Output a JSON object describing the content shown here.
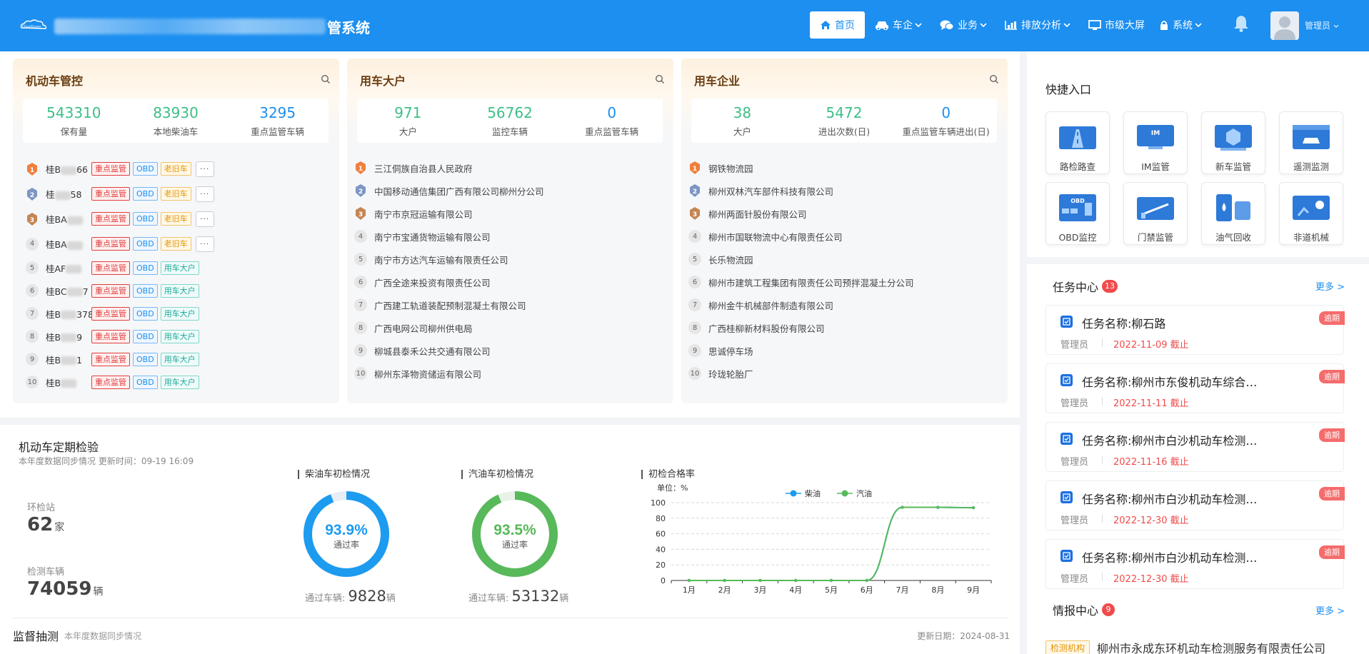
{
  "header": {
    "logo_text": "CloudScape",
    "title_suffix": "管系统",
    "nav": [
      {
        "label": "首页",
        "icon": "home-icon",
        "active": true
      },
      {
        "label": "车企",
        "icon": "car-icon",
        "caret": true
      },
      {
        "label": "业务",
        "icon": "chat-icon",
        "caret": true
      },
      {
        "label": "排放分析",
        "icon": "bar-chart-icon",
        "caret": true
      },
      {
        "label": "市级大屏",
        "icon": "monitor-icon"
      },
      {
        "label": "系统",
        "icon": "lock-icon",
        "caret": true
      }
    ],
    "user_label": "管理员"
  },
  "vehicles": {
    "title": "机动车管控",
    "stats": [
      {
        "value": "543310",
        "label": "保有量"
      },
      {
        "value": "83930",
        "label": "本地柴油车"
      },
      {
        "value": "3295",
        "label": "重点监管车辆"
      }
    ],
    "rows": [
      {
        "rank": "1",
        "plate_a": "桂B",
        "plate_b": "66",
        "tags": [
          "重点监管",
          "OBD",
          "老旧车"
        ],
        "more": "···"
      },
      {
        "rank": "2",
        "plate_a": "桂",
        "plate_b": "58",
        "tags": [
          "重点监管",
          "OBD",
          "老旧车"
        ],
        "more": "···"
      },
      {
        "rank": "3",
        "plate_a": "桂BA",
        "plate_b": "",
        "tags": [
          "重点监管",
          "OBD",
          "老旧车"
        ],
        "more": "···"
      },
      {
        "rank": "4",
        "plate_a": "桂BA",
        "plate_b": "",
        "tags": [
          "重点监管",
          "OBD",
          "老旧车"
        ],
        "more": "···"
      },
      {
        "rank": "5",
        "plate_a": "桂AF",
        "plate_b": "",
        "tags": [
          "重点监管",
          "OBD",
          "用车大户"
        ]
      },
      {
        "rank": "6",
        "plate_a": "桂BC",
        "plate_b": "7",
        "tags": [
          "重点监管",
          "OBD",
          "用车大户"
        ]
      },
      {
        "rank": "7",
        "plate_a": "桂B",
        "plate_b": "378",
        "tags": [
          "重点监管",
          "OBD",
          "用车大户"
        ]
      },
      {
        "rank": "8",
        "plate_a": "桂B",
        "plate_b": "9",
        "tags": [
          "重点监管",
          "OBD",
          "用车大户"
        ]
      },
      {
        "rank": "9",
        "plate_a": "桂B",
        "plate_b": "1",
        "tags": [
          "重点监管",
          "OBD",
          "用车大户"
        ]
      },
      {
        "rank": "10",
        "plate_a": "桂B",
        "plate_b": "",
        "tags": [
          "重点监管",
          "OBD",
          "用车大户"
        ]
      }
    ]
  },
  "big_users": {
    "title": "用车大户",
    "stats": [
      {
        "value": "971",
        "label": "大户"
      },
      {
        "value": "56762",
        "label": "监控车辆"
      },
      {
        "value": "0",
        "label": "重点监管车辆"
      }
    ],
    "rows": [
      {
        "rank": "1",
        "name": "三江侗族自治县人民政府"
      },
      {
        "rank": "2",
        "name": "中国移动通信集团广西有限公司柳州分公司"
      },
      {
        "rank": "3",
        "name": "南宁市京冠运输有限公司"
      },
      {
        "rank": "4",
        "name": "南宁市宝通货物运输有限公司"
      },
      {
        "rank": "5",
        "name": "南宁市方达汽车运输有限责任公司"
      },
      {
        "rank": "6",
        "name": "广西全途来投资有限责任公司"
      },
      {
        "rank": "7",
        "name": "广西建工轨道装配预制混凝土有限公司"
      },
      {
        "rank": "8",
        "name": "广西电网公司柳州供电局"
      },
      {
        "rank": "9",
        "name": "柳城县泰禾公共交通有限公司"
      },
      {
        "rank": "10",
        "name": "柳州东泽物资储运有限公司"
      }
    ]
  },
  "enterprises": {
    "title": "用车企业",
    "stats": [
      {
        "value": "38",
        "label": "大户"
      },
      {
        "value": "5472",
        "label": "进出次数(日)"
      },
      {
        "value": "0",
        "label": "重点监管车辆进出(日)"
      }
    ],
    "rows": [
      {
        "rank": "1",
        "name": "钢铁物流园"
      },
      {
        "rank": "2",
        "name": "柳州双林汽车部件科技有限公司"
      },
      {
        "rank": "3",
        "name": "柳州两面针股份有限公司"
      },
      {
        "rank": "4",
        "name": "柳州市国联物流中心有限责任公司"
      },
      {
        "rank": "5",
        "name": "长乐物流园"
      },
      {
        "rank": "6",
        "name": "柳州市建筑工程集团有限责任公司预拌混凝土分公司"
      },
      {
        "rank": "7",
        "name": "柳州金牛机械部件制造有限公司"
      },
      {
        "rank": "8",
        "name": "广西桂柳新材料股份有限公司"
      },
      {
        "rank": "9",
        "name": "思诚停车场"
      },
      {
        "rank": "10",
        "name": "玲珑轮胎厂"
      }
    ]
  },
  "quick": {
    "title": "快捷入口",
    "items": [
      {
        "label": "路检路查",
        "icon": "road-check-icon"
      },
      {
        "label": "IM监管",
        "icon": "im-monitor-icon",
        "icon_text": "IM"
      },
      {
        "label": "新车监管",
        "icon": "new-car-icon"
      },
      {
        "label": "遥测监测",
        "icon": "telemetry-icon"
      },
      {
        "label": "OBD监控",
        "icon": "obd-icon",
        "icon_text": "OBD"
      },
      {
        "label": "门禁监管",
        "icon": "gate-icon"
      },
      {
        "label": "油气回收",
        "icon": "oil-gas-icon"
      },
      {
        "label": "非道机械",
        "icon": "machinery-icon"
      }
    ]
  },
  "tasks": {
    "title": "任务中心",
    "count": "13",
    "more": "更多 >",
    "items": [
      {
        "name": "任务名称:柳石路",
        "user": "管理员",
        "date": "2022-11-09 截止",
        "flag": "逾期"
      },
      {
        "name": "任务名称:柳州市东俊机动车综合…",
        "user": "管理员",
        "date": "2022-11-11 截止",
        "flag": "逾期"
      },
      {
        "name": "任务名称:柳州市白沙机动车检测…",
        "user": "管理员",
        "date": "2022-11-16 截止",
        "flag": "逾期"
      },
      {
        "name": "任务名称:柳州市白沙机动车检测…",
        "user": "管理员",
        "date": "2022-12-30 截止",
        "flag": "逾期"
      },
      {
        "name": "任务名称:柳州市白沙机动车检测…",
        "user": "管理员",
        "date": "2022-12-30 截止",
        "flag": "逾期"
      }
    ]
  },
  "intel": {
    "title": "情报中心",
    "count": "9",
    "more": "更多 >",
    "first": {
      "tag": "检测机构",
      "text": "柳州市永成东环机动车检测服务有限责任公司"
    }
  },
  "inspection": {
    "title": "机动车定期检验",
    "subtitle": "本年度数据同步情况 更新时间：09-19 16:09",
    "stations_label": "环检站",
    "stations_value": "62",
    "stations_unit": "家",
    "vehicles_label": "检测车辆",
    "vehicles_value": "74059",
    "vehicles_unit": "辆",
    "diesel": {
      "title": "柴油车初检情况",
      "rate": "93.9%",
      "rate_value": 0.939,
      "rate_label": "通过率",
      "pass_label": "通过车辆:",
      "pass_value": "9828",
      "unit": "辆"
    },
    "gasoline": {
      "title": "汽油车初检情况",
      "rate": "93.5%",
      "rate_value": 0.935,
      "rate_label": "通过率",
      "pass_label": "通过车辆:",
      "pass_value": "53132",
      "unit": "辆"
    },
    "line_title": "初检合格率"
  },
  "supervision": {
    "title": "监督抽测",
    "subtitle": "本年度数据同步情况",
    "date": "更新日期：2024-08-31"
  },
  "colors": {
    "primary": "#1c8ff0",
    "diesel": "#1c9bef",
    "gasoline": "#58b95b",
    "danger": "#f14a4a"
  },
  "chart_data": {
    "type": "line",
    "title": "初检合格率",
    "unit_label": "单位：%",
    "categories": [
      "1月",
      "2月",
      "3月",
      "4月",
      "5月",
      "6月",
      "7月",
      "8月",
      "9月"
    ],
    "series": [
      {
        "name": "柴油",
        "values": [
          0,
          0,
          0,
          0,
          0,
          0,
          94,
          94,
          93.5
        ]
      },
      {
        "name": "汽油",
        "values": [
          0,
          0,
          0,
          0,
          0,
          0,
          94,
          94,
          93.5
        ]
      }
    ],
    "ylim": [
      0,
      100
    ],
    "yticks": [
      0,
      20,
      40,
      60,
      80,
      100
    ],
    "grid": true,
    "legend": "top"
  }
}
